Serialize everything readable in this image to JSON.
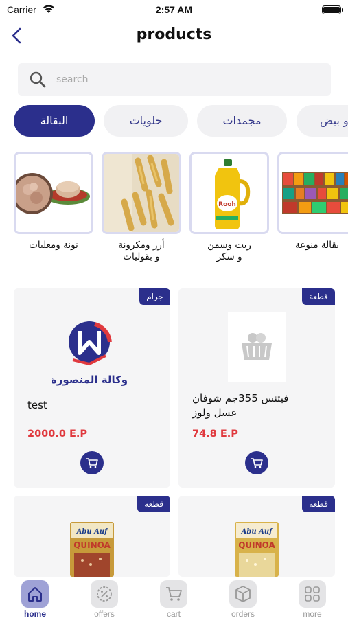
{
  "status_bar": {
    "carrier": "Carrier",
    "time": "2:57 AM"
  },
  "header": {
    "title": "products"
  },
  "search": {
    "placeholder": "search"
  },
  "colors": {
    "primary": "#2b2f8c",
    "price": "#e0393e",
    "tab_bg": "#f1f1f3",
    "card_bg": "#f5f5f6"
  },
  "tabs": [
    {
      "label": "البقالة",
      "active": true
    },
    {
      "label": "حلويات",
      "active": false
    },
    {
      "label": "مجمدات",
      "active": false
    },
    {
      "label": "و بيض",
      "active": false
    }
  ],
  "subcategories": [
    {
      "label": "تونة ومعلبات"
    },
    {
      "label": "أرز ومكرونة\nو بقوليات"
    },
    {
      "label": "زيت وسمن\nو سكر"
    },
    {
      "label": "بقالة منوعة"
    }
  ],
  "products": [
    {
      "name": "test",
      "price": "2000.0 E.P",
      "unit": "جرام",
      "logo_text": "وكالة المنصورة"
    },
    {
      "name": "فيتنس 355جم شوفان\nعسل ولوز",
      "price": "74.8 E.P",
      "unit": "قطعة"
    },
    {
      "name": "",
      "price": "",
      "unit": "قطعة",
      "pkg_brand": "Abu Auf",
      "pkg_text": "QUINOA"
    },
    {
      "name": "",
      "price": "",
      "unit": "قطعة",
      "pkg_brand": "Abu Auf",
      "pkg_text": "QUINOA"
    }
  ],
  "bottom_nav": [
    {
      "label": "home",
      "icon": "home-icon",
      "active": true
    },
    {
      "label": "offers",
      "icon": "offers-icon",
      "active": false
    },
    {
      "label": "cart",
      "icon": "cart-icon",
      "active": false
    },
    {
      "label": "orders",
      "icon": "orders-icon",
      "active": false
    },
    {
      "label": "more",
      "icon": "more-icon",
      "active": false
    }
  ]
}
